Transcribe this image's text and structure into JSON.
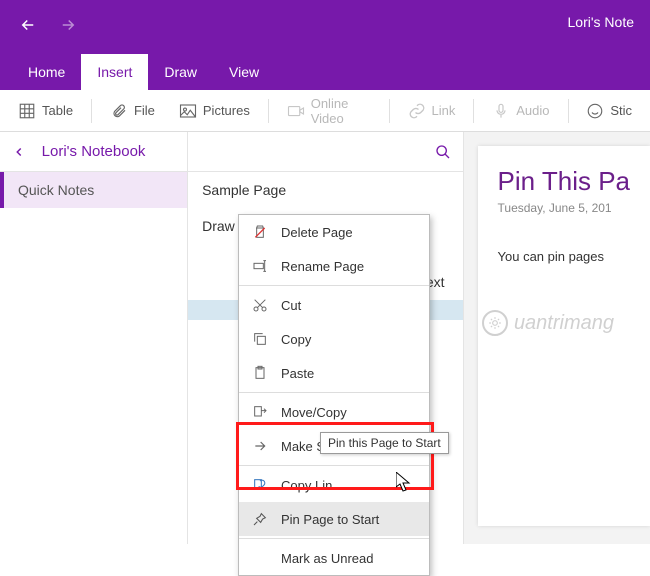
{
  "titlebar": {
    "window_title": "Lori's Note"
  },
  "ribbon_tabs": {
    "home": "Home",
    "insert": "Insert",
    "draw": "Draw",
    "view": "View"
  },
  "ribbon": {
    "table": "Table",
    "file": "File",
    "pictures": "Pictures",
    "online_video": "Online Video",
    "link": "Link",
    "audio": "Audio",
    "stickers": "Stic"
  },
  "sidebar": {
    "notebook_title": "Lori's Notebook",
    "sections": [
      "Quick Notes"
    ]
  },
  "pagelist": {
    "search_placeholder": "Search",
    "pages": [
      "Sample Page",
      "Draw on Pages in OneNote"
    ],
    "partial_1": "",
    "text_row": "Text",
    "selected_row": ""
  },
  "noteview": {
    "title": "Pin This Pa",
    "date": "Tuesday, June 5, 201",
    "body": "You can pin pages"
  },
  "context_menu": {
    "delete": "Delete Page",
    "rename": "Rename Page",
    "cut": "Cut",
    "copy": "Copy",
    "paste": "Paste",
    "move_copy": "Move/Copy",
    "make_subpage": "Make Subpage",
    "copy_link": "Copy Lin",
    "pin_start": "Pin Page to Start",
    "mark_unread": "Mark as Unread"
  },
  "tooltip": {
    "text": "Pin this Page to Start"
  },
  "watermark": {
    "text": "uantrimang"
  }
}
